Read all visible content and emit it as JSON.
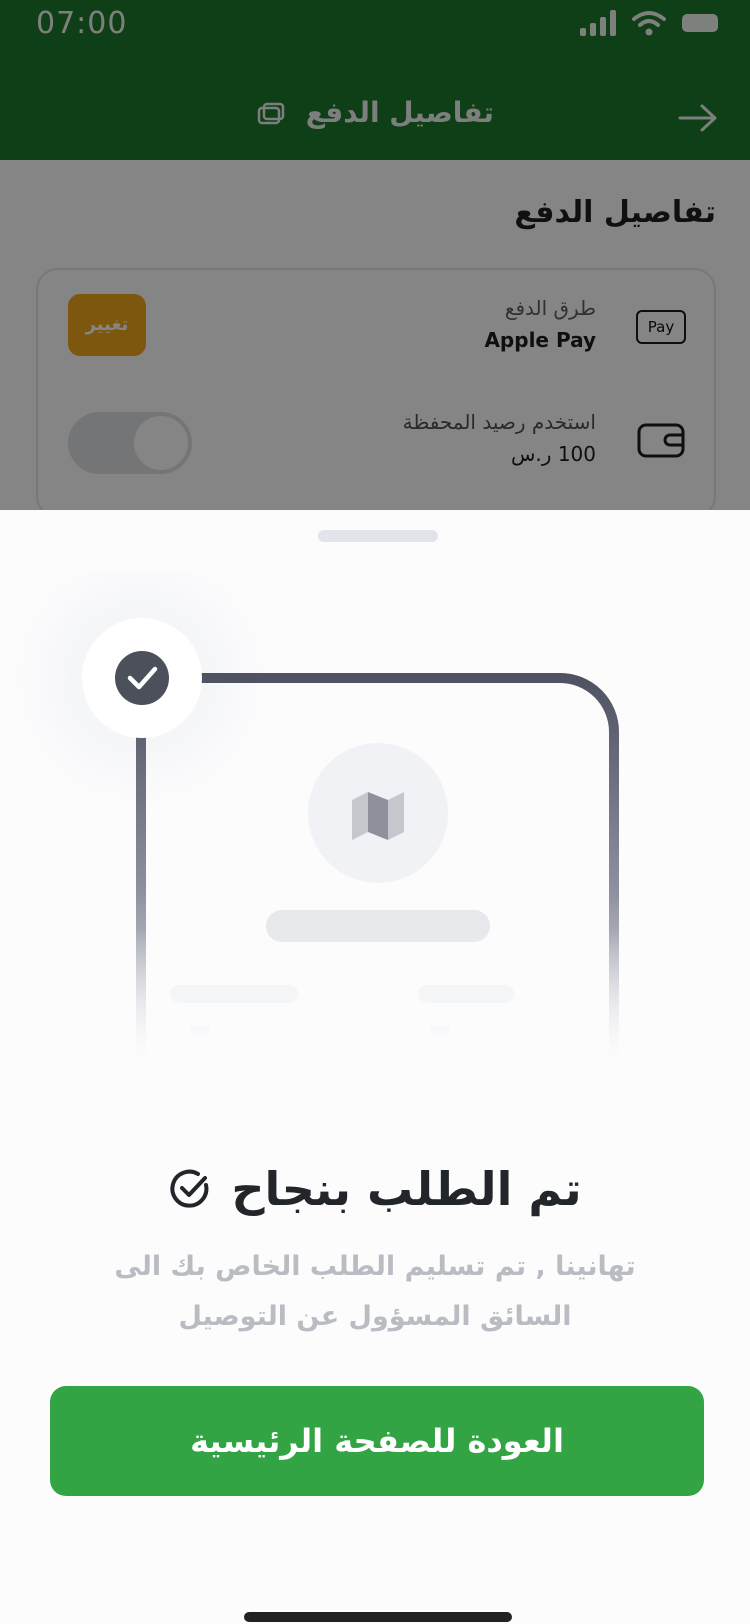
{
  "status_bar": {
    "time": "07:00"
  },
  "app_bar": {
    "title": "تفاصيل الدفع",
    "icons": [
      "doc-icon",
      "back-arrow-icon"
    ]
  },
  "payment": {
    "section_title": "تفاصيل الدفع",
    "method_label": "طرق الدفع",
    "method_value": "Apple Pay",
    "badge_text": "Pay",
    "change_label": "تغيير",
    "wallet_label": "استخدم رصيد المحفظة",
    "wallet_amount": "100 ر.س"
  },
  "sheet": {
    "title": "تم الطلب بنجاح",
    "subtitle": "تهانينا , تم تسليم الطلب الخاص بك الى السائق المسؤول عن التوصيل",
    "button_label": "العودة للصفحة الرئيسية",
    "illustration_icons": [
      "check-badge-icon",
      "map-icon"
    ]
  },
  "colors": {
    "app_bar": "#1d7a2c",
    "primary_button": "#32a444",
    "change_button": "#f0a81b",
    "title_text": "#222529",
    "subtitle_text": "#b9bcc3"
  }
}
